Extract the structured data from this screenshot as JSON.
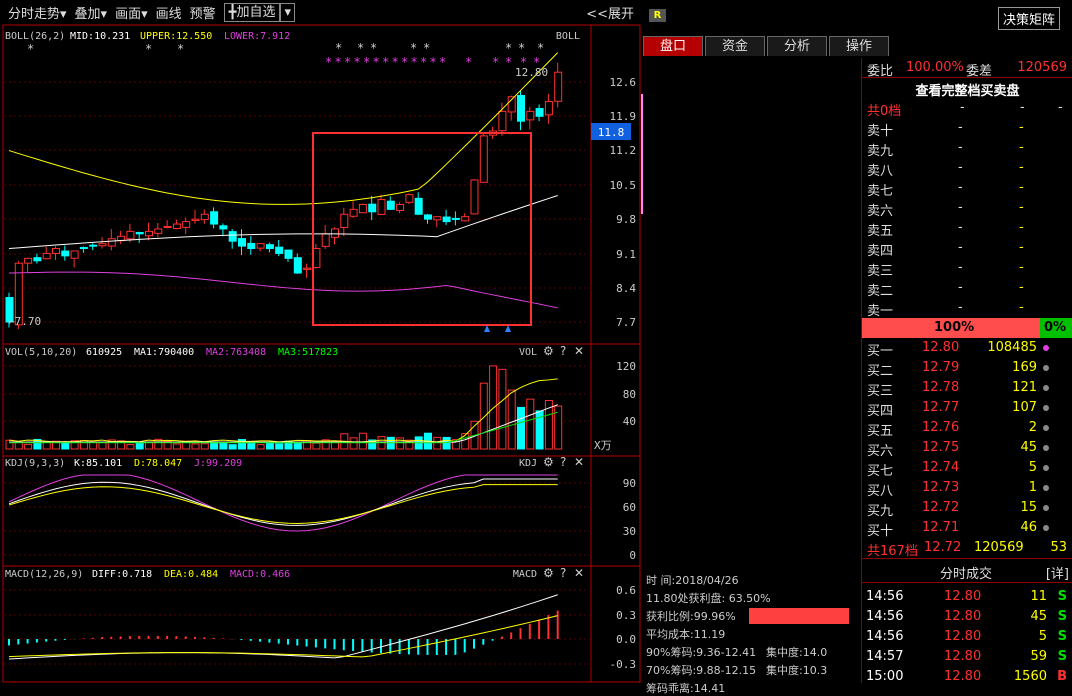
{
  "toolbar": {
    "items": [
      "分时走势▾",
      "叠加▾",
      "画面▾",
      "画线",
      "预警"
    ],
    "add_label": "╋加自选",
    "add_dropdown": "▾",
    "expand_label": "<<展开"
  },
  "boll": {
    "title": "BOLL(26,2)",
    "mid": "MID:10.231",
    "upper": "UPPER:12.550",
    "lower": "LOWER:7.912",
    "tag": "BOLL",
    "high_label": "12.80",
    "low_label": "←7.70",
    "current_price_label": "11.8",
    "price_ticks": [
      "12.6",
      "11.9",
      "11.2",
      "10.5",
      "9.8",
      "9.1",
      "8.4",
      "7.7"
    ]
  },
  "vol": {
    "title": "VOL(5,10,20)",
    "value": "610925",
    "ma1": "MA1:790400",
    "ma2": "MA2:763408",
    "ma3": "MA3:517823",
    "tag": "VOL",
    "ticks": [
      "120",
      "80",
      "40"
    ],
    "unit": "X万"
  },
  "kdj": {
    "title": "KDJ(9,3,3)",
    "k": "K:85.101",
    "d": "D:78.047",
    "j": "J:99.209",
    "tag": "KDJ",
    "ticks": [
      "90",
      "60",
      "30",
      "0"
    ]
  },
  "macd": {
    "title": "MACD(12,26,9)",
    "diff": "DIFF:0.718",
    "dea": "DEA:0.484",
    "macd": "MACD:0.466",
    "tag": "MACD",
    "ticks": [
      "0.6",
      "0.3",
      "0.0",
      "-0.3"
    ]
  },
  "colors": {
    "up": "#ff3030",
    "down": "#00ffff",
    "ma_yellow": "#ffff00",
    "ma_magenta": "#e040e0",
    "ma_white": "#ffffff",
    "ma_green": "#00e000",
    "frame": "#b40000"
  },
  "right": {
    "badge": "R",
    "decision_button": "决策矩阵",
    "tabs": [
      "盘口",
      "资金",
      "分析",
      "操作"
    ],
    "weibi_label": "委比",
    "weibi_value": "100.00%",
    "weicha_label": "委差",
    "weicha_value": "120569",
    "view_all": "查看完整档买卖盘",
    "sell_total": "共0档",
    "sell_rows": [
      "卖十",
      "卖九",
      "卖八",
      "卖七",
      "卖六",
      "卖五",
      "卖四",
      "卖三",
      "卖二",
      "卖一"
    ],
    "dash": "-",
    "ratio_left": "100%",
    "ratio_right": "0%",
    "buy_rows": [
      {
        "label": "买一",
        "price": "12.80",
        "vol": "108485"
      },
      {
        "label": "买二",
        "price": "12.79",
        "vol": "169"
      },
      {
        "label": "买三",
        "price": "12.78",
        "vol": "121"
      },
      {
        "label": "买四",
        "price": "12.77",
        "vol": "107"
      },
      {
        "label": "买五",
        "price": "12.76",
        "vol": "2"
      },
      {
        "label": "买六",
        "price": "12.75",
        "vol": "45"
      },
      {
        "label": "买七",
        "price": "12.74",
        "vol": "5"
      },
      {
        "label": "买八",
        "price": "12.73",
        "vol": "1"
      },
      {
        "label": "买九",
        "price": "12.72",
        "vol": "15"
      },
      {
        "label": "买十",
        "price": "12.71",
        "vol": "46"
      }
    ],
    "buy_total_label": "共167档",
    "buy_total_price": "12.72",
    "buy_total_vol": "120569",
    "buy_total_extra": "53",
    "ticks_title": "分时成交",
    "ticks_detail": "[详]",
    "trades": [
      {
        "time": "14:56",
        "price": "12.80",
        "vol": "11",
        "side": "S"
      },
      {
        "time": "14:56",
        "price": "12.80",
        "vol": "45",
        "side": "S"
      },
      {
        "time": "14:56",
        "price": "12.80",
        "vol": "5",
        "side": "S"
      },
      {
        "time": "14:57",
        "price": "12.80",
        "vol": "59",
        "side": "S"
      },
      {
        "time": "15:00",
        "price": "12.80",
        "vol": "1560",
        "side": "B"
      }
    ]
  },
  "chips": {
    "time_label": "时      间:2018/04/26",
    "profit_line": "11.80处获利盘: 63.50%",
    "profit_ratio": "获利比例:99.96%",
    "avg_cost": "平均成本:11.19",
    "c90": "90%筹码:9.36-12.41",
    "c90_conc": "集中度:14.0",
    "c70": "70%筹码:9.88-12.15",
    "c70_conc": "集中度:10.3",
    "spread": "筹码乖离:14.41",
    "profit_fraction": 0.9996
  }
}
